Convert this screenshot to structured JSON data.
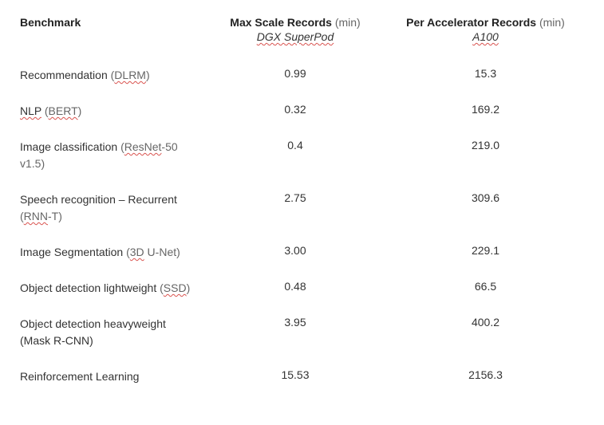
{
  "headers": {
    "col1": "Benchmark",
    "col2_label": "Max Scale Records",
    "col2_unit": "(min)",
    "col2_sub_spell": "DGX SuperPod",
    "col3_label": "Per Accelerator Records",
    "col3_unit": "(min)",
    "col3_sub_spell": "A100"
  },
  "rows": [
    {
      "name_plain": "Recommendation ",
      "name_paren_open": "(",
      "name_spell": "DLRM",
      "name_paren_close": ")",
      "name_after": "",
      "max": "0.99",
      "per": "15.3"
    },
    {
      "name_spell_first": "NLP",
      "name_paren_open": " (",
      "name_spell": "BERT",
      "name_paren_close": ")",
      "max": "0.32",
      "per": "169.2"
    },
    {
      "name_plain": "Image classification ",
      "name_paren_open": "(",
      "name_spell": "ResNet",
      "name_paren_close": "-50 v1.5)",
      "max": "0.4",
      "per": "219.0"
    },
    {
      "name_plain": "Speech recognition – Recurrent ",
      "name_paren_open": "(",
      "name_spell": "RNN",
      "name_paren_close": "-T)",
      "max": "2.75",
      "per": "309.6"
    },
    {
      "name_plain": "Image Segmentation ",
      "name_paren_open": "(",
      "name_spell": "3D",
      "name_paren_close": " U-Net)",
      "max": "3.00",
      "per": "229.1"
    },
    {
      "name_plain": "Object detection lightweight ",
      "name_paren_open": "(",
      "name_spell": "SSD",
      "name_paren_close": ")",
      "max": "0.48",
      "per": "66.5"
    },
    {
      "name_plain": "Object detection heavyweight (Mask R-CNN)",
      "max": "3.95",
      "per": "400.2"
    },
    {
      "name_plain": "Reinforcement Learning",
      "max": "15.53",
      "per": "2156.3"
    }
  ]
}
